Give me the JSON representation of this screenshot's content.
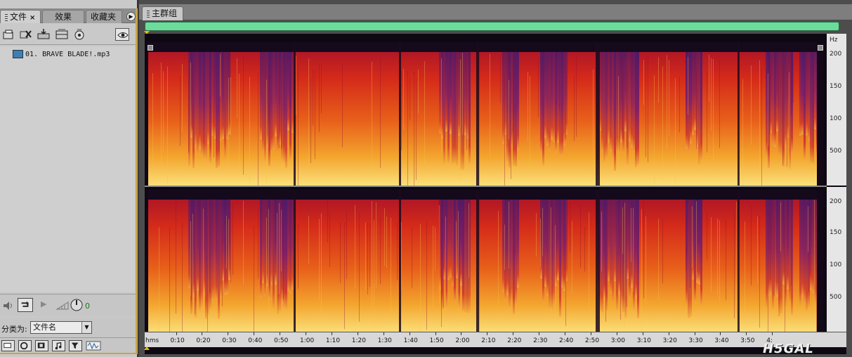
{
  "left_panel": {
    "tabs": [
      {
        "label": "文件",
        "active": true,
        "close": "×"
      },
      {
        "label": "效果",
        "active": false
      },
      {
        "label": "收藏夹",
        "active": false
      }
    ],
    "files": [
      {
        "name": "01. BRAVE BLADE!.mp3",
        "icon": "audio-file-icon"
      }
    ],
    "level_value": "0",
    "sort_label": "分类为:",
    "sort_value": "文件名"
  },
  "right_panel": {
    "tab_label": "主群组",
    "overview_color": "#6bdc9a",
    "y_unit": "Hz",
    "y_ticks_top": [
      "200",
      "150",
      "100",
      "500"
    ],
    "y_ticks_bottom": [
      "200",
      "150",
      "100",
      "500"
    ],
    "time_unit_label": "hms",
    "time_labels": [
      "0:10",
      "0:20",
      "0:30",
      "0:40",
      "0:50",
      "1:00",
      "1:10",
      "1:20",
      "1:30",
      "1:40",
      "1:50",
      "2:00",
      "2:10",
      "2:20",
      "2:30",
      "2:40",
      "2:50",
      "3:00",
      "3:10",
      "3:20",
      "3:30",
      "3:40",
      "3:50",
      "4:"
    ],
    "watermark": "H5GAL"
  }
}
